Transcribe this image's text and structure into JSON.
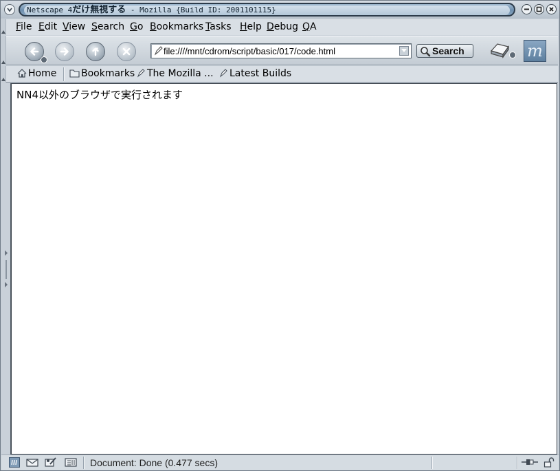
{
  "window": {
    "title_prefix": "Netscape 4",
    "title_japanese": "だけ無視する",
    "title_suffix": " - Mozilla {Build ID: 2001101115}"
  },
  "menu": {
    "items": [
      {
        "key": "F",
        "rest": "ile"
      },
      {
        "key": "E",
        "rest": "dit"
      },
      {
        "key": "V",
        "rest": "iew"
      },
      {
        "key": "S",
        "rest": "earch"
      },
      {
        "key": "G",
        "rest": "o"
      },
      {
        "key": "B",
        "rest": "ookmarks"
      },
      {
        "key": "T",
        "rest": "asks"
      },
      {
        "key": "H",
        "rest": "elp"
      },
      {
        "key": "D",
        "rest": "ebug"
      },
      {
        "key": "Q",
        "rest": "A"
      }
    ]
  },
  "navigation": {
    "url": "file:////mnt/cdrom/script/basic/017/code.html",
    "search_label": "Search",
    "throbber_letter": "m",
    "icons": {
      "back": "back-arrow-icon",
      "forward": "forward-arrow-icon",
      "reload": "reload-icon",
      "stop": "stop-icon",
      "print": "print-icon"
    }
  },
  "personal_toolbar": {
    "home": "Home",
    "bookmarks": "Bookmarks",
    "mozilla": "The Mozilla ...",
    "latest": "Latest Builds"
  },
  "content": {
    "text": "NN4以外のブラウザで実行されます"
  },
  "status": {
    "text": "Document: Done (0.477 secs)"
  },
  "colors": {
    "chrome": "#c9d1d9",
    "title_accent": "#6e8fae",
    "content_bg": "#ffffff"
  }
}
